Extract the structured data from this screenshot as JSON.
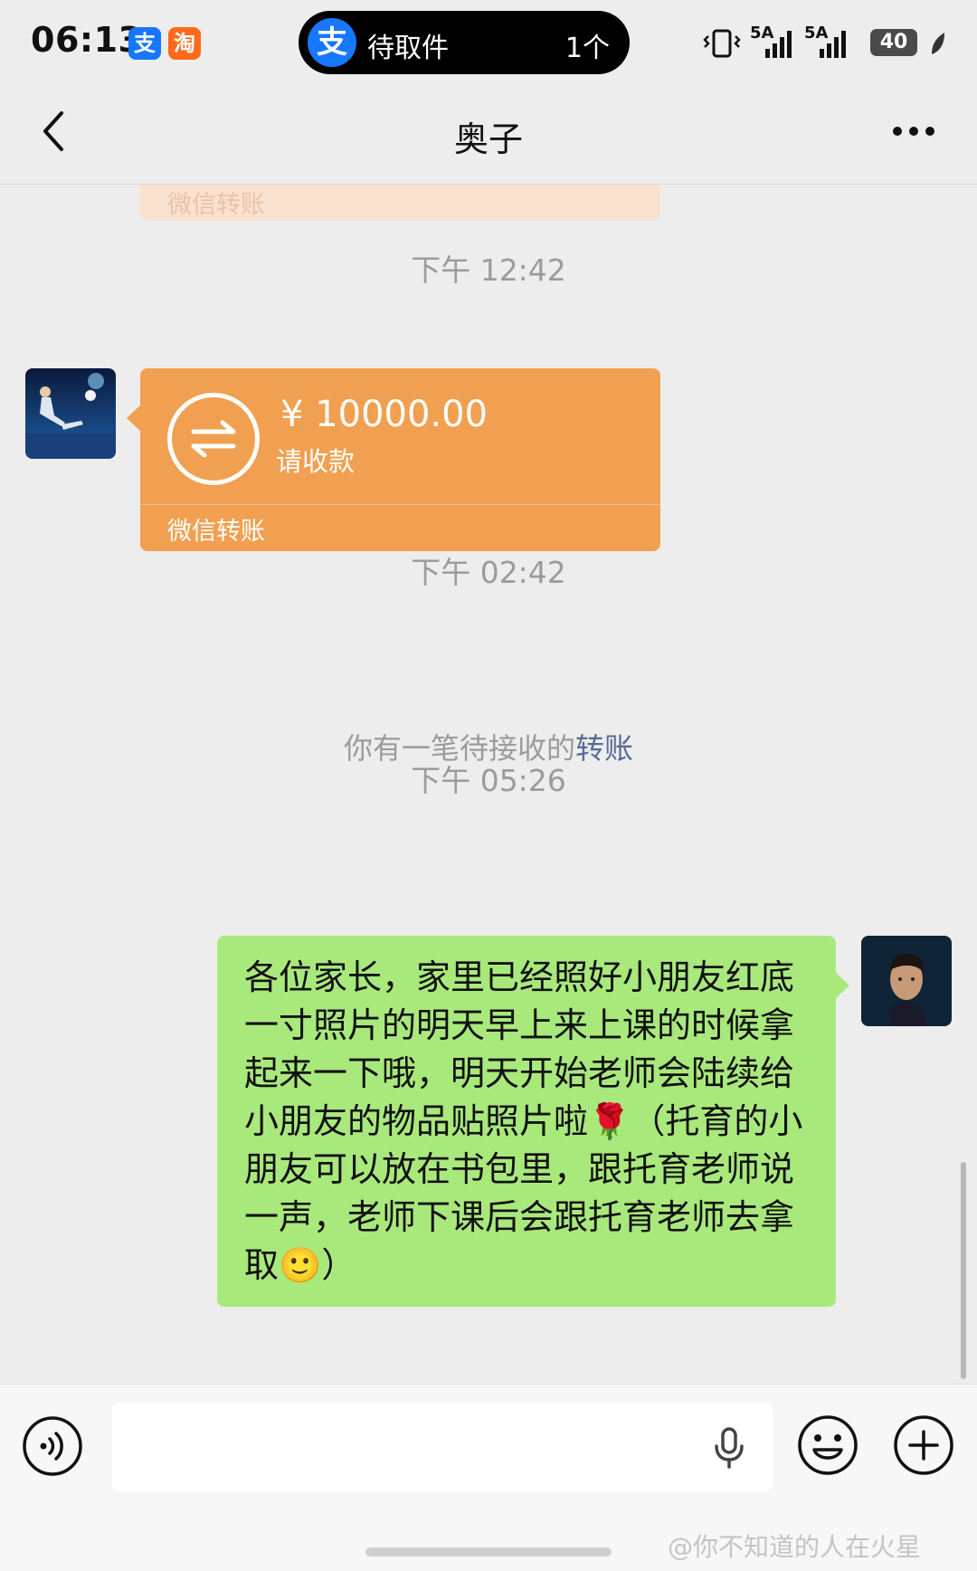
{
  "status_bar": {
    "time": "06:13",
    "app_badges": [
      "支",
      "淘"
    ],
    "island_logo": "支",
    "island_text": "待取件",
    "island_count": "1个",
    "signal_1": "5A",
    "signal_2": "5A",
    "battery": "40"
  },
  "nav": {
    "title": "奥子",
    "back_icon": "chevron-left-icon",
    "more_icon": "more-dots-icon"
  },
  "messages": {
    "prev_transfer_footer": "微信转账",
    "timestamp_1": "下午 12:42",
    "transfer": {
      "amount": "¥ 10000.00",
      "status": "请收款",
      "footer": "微信转账",
      "color": "#f0a050"
    },
    "timestamp_2": "下午 02:42",
    "system_text": "你有一笔待接收的",
    "system_link": "转账",
    "timestamp_3": "下午 05:26",
    "outgoing_text": "各位家长，家里已经照好小朋友红底一寸照片的明天早上来上课的时候拿起来一下哦，明天开始老师会陆续给小朋友的物品贴照片啦🌹（托育的小朋友可以放在书包里，跟托育老师说一声，老师下课后会跟托育老师去拿取🙂）",
    "bubble_color": "#a9e97c"
  },
  "input_bar": {
    "voice_icon": "voice-icon",
    "mic_icon": "microphone-icon",
    "emoji_icon": "emoji-icon",
    "plus_icon": "plus-icon"
  },
  "watermark": "@你不知道的人在火星"
}
